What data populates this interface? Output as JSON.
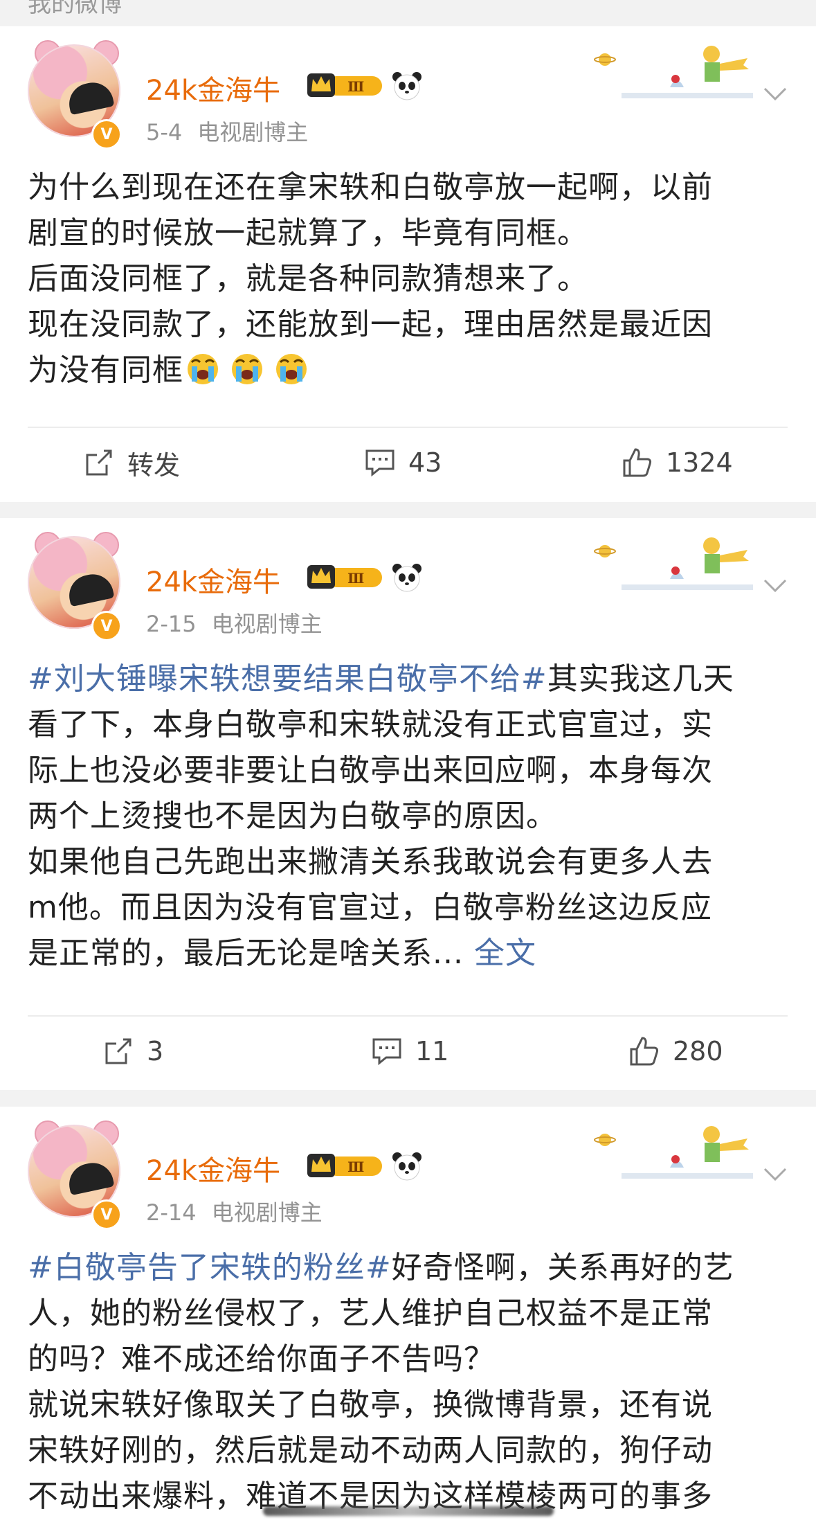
{
  "header": {
    "partial_label": "我的微博"
  },
  "posts": [
    {
      "username": "24k金海牛",
      "vip_badge": "Ⅲ",
      "verified_mark": "V",
      "date": "5-4",
      "role": "电视剧博主",
      "lines": [
        "为什么到现在还在拿宋轶和白敬亭放一起啊，以前",
        "剧宣的时候放一起就算了，毕竟有同框。",
        "后面没同框了，就是各种同款猜想来了。",
        "现在没同款了，还能放到一起，理由居然是最近因",
        "为没有同框"
      ],
      "repost_label": "转发",
      "comments": "43",
      "likes": "1324"
    },
    {
      "username": "24k金海牛",
      "vip_badge": "Ⅲ",
      "verified_mark": "V",
      "date": "2-15",
      "role": "电视剧博主",
      "topic": "#刘大锤曝宋轶想要结果白敬亭不给#",
      "line1_rest": "其实我这几天",
      "lines": [
        "看了下，本身白敬亭和宋轶就没有正式官宣过，实",
        "际上也没必要非要让白敬亭出来回应啊，本身每次",
        "两个上烫搜也不是因为白敬亭的原因。",
        "如果他自己先跑出来撇清关系我敢说会有更多人去",
        "m他。而且因为没有官宣过，白敬亭粉丝这边反应"
      ],
      "last_line": "是正常的，最后无论是啥关系...",
      "more_label": "全文",
      "reposts": "3",
      "comments": "11",
      "likes": "280"
    },
    {
      "username": "24k金海牛",
      "vip_badge": "Ⅲ",
      "verified_mark": "V",
      "date": "2-14",
      "role": "电视剧博主",
      "topic": "#白敬亭告了宋轶的粉丝#",
      "line1_rest": "好奇怪啊，关系再好的艺",
      "lines": [
        "人，她的粉丝侵权了，艺人维护自己权益不是正常",
        "的吗？难不成还给你面子不告吗？",
        "就说宋轶好像取关了白敬亭，换微博背景，还有说",
        "宋轶好刚的，然后就是动不动两人同款的，狗仔动",
        "不动出来爆料，难道不是因为这样模棱两可的事多"
      ]
    }
  ],
  "icons": {
    "repost": "repost-icon",
    "comment": "comment-icon",
    "like": "thumbs-up-icon",
    "more": "chevron-down-icon",
    "crying_emoji": "crying-face-emoji",
    "panda": "panda-icon",
    "crown": "vip-crown-icon"
  },
  "colors": {
    "username": "#e86b0a",
    "topic_link": "#4a6ea8",
    "meta_text": "#939393",
    "body_text": "#222222",
    "page_bg": "#f2f2f2"
  }
}
